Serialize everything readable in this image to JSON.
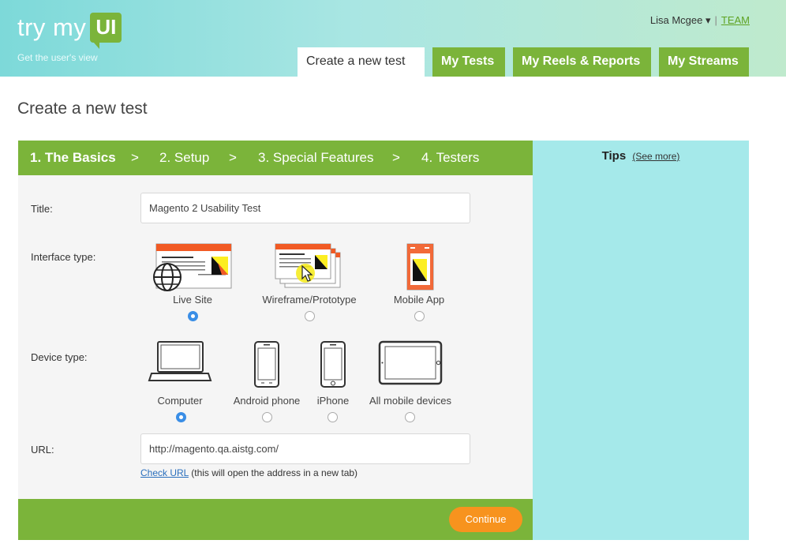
{
  "header": {
    "logo_text": "try my",
    "logo_box": "UI",
    "tagline": "Get the user's view",
    "user_name": "Lisa Mcgee ▾",
    "separator": "|",
    "team_link": "TEAM",
    "nav": [
      {
        "label": "Create a new test",
        "active": true
      },
      {
        "label": "My Tests"
      },
      {
        "label": "My Reels & Reports"
      },
      {
        "label": "My Streams"
      }
    ]
  },
  "page_title": "Create a new test",
  "steps": [
    {
      "label": "1. The Basics",
      "active": true
    },
    {
      "label": "2. Setup"
    },
    {
      "label": "3. Special Features"
    },
    {
      "label": "4. Testers"
    }
  ],
  "step_separator": ">",
  "form": {
    "title_label": "Title:",
    "title_value": "Magento 2 Usability Test",
    "interface_label": "Interface type:",
    "interface_options": [
      {
        "label": "Live Site",
        "selected": true,
        "icon": "live-site-icon"
      },
      {
        "label": "Wireframe/Prototype",
        "selected": false,
        "icon": "wireframe-prototype-icon"
      },
      {
        "label": "Mobile App",
        "selected": false,
        "icon": "mobile-app-icon"
      }
    ],
    "device_label": "Device type:",
    "device_options": [
      {
        "label": "Computer",
        "selected": true,
        "icon": "laptop-icon"
      },
      {
        "label": "Android phone",
        "selected": false,
        "icon": "android-phone-icon"
      },
      {
        "label": "iPhone",
        "selected": false,
        "icon": "iphone-icon"
      },
      {
        "label": "All mobile devices",
        "selected": false,
        "icon": "tablet-icon"
      }
    ],
    "url_label": "URL:",
    "url_value": "http://magento.qa.aistg.com/",
    "check_url_link": "Check URL",
    "check_url_note": "(this will open the address in a new tab)",
    "continue_label": "Continue"
  },
  "tips": {
    "title": "Tips",
    "see_more": "(See more)"
  },
  "colors": {
    "brand_green": "#7bb43a",
    "tips_bg": "#a5e9ea",
    "continue_orange": "#f7931e",
    "radio_blue": "#3a8ee6"
  }
}
